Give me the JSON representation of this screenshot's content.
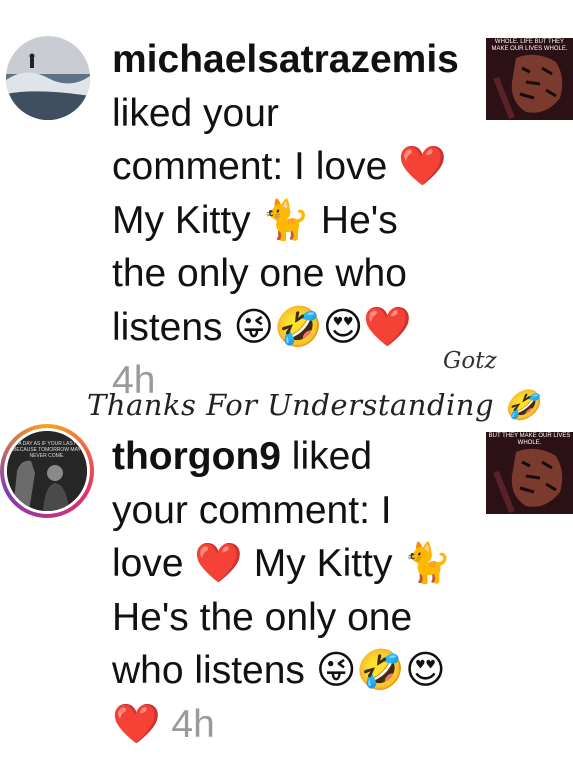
{
  "notifications": [
    {
      "username": "michaelsatrazemis",
      "action": " liked your comment: I love ",
      "part_heart": "❤️",
      "part2": " My Kitty ",
      "part_cat": "🐈",
      "part3": " He's the only one who listens ",
      "emojis": "😜🤣😍❤️",
      "time": "4h",
      "thumbnail_caption": "WHOLE. LIFE BUT THEY MAKE OUR LIVES WHOLE."
    },
    {
      "username": "thorgon9",
      "action": " liked your comment: I love ",
      "part_heart": "❤️",
      "part2": " My Kitty ",
      "part_cat": "🐈",
      "part3": " He's the only one who listens ",
      "emojis": "😜🤣😍❤️",
      "time": "4h",
      "thumbnail_caption": "BUT THEY MAKE OUR LIVES WHOLE.",
      "avatar_caption": "A DAY AS IF YOUR LAST BECAUSE TOMORROW MAY NEVER COME."
    }
  ],
  "overlay": {
    "watermark": "Thanks For Understanding 🤣",
    "signature": "Gotz"
  }
}
